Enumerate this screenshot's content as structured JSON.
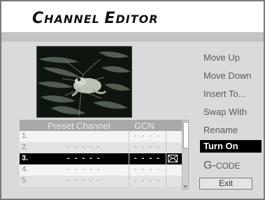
{
  "title": {
    "parts": [
      {
        "text": "C",
        "cap": true
      },
      {
        "text": "HANNEL ",
        "cap": false
      },
      {
        "text": "E",
        "cap": true
      },
      {
        "text": "DITOR",
        "cap": false
      }
    ]
  },
  "preview": {
    "icon": "frog-on-leaves-video-preview"
  },
  "table": {
    "headers": {
      "preset": "Preset Channel",
      "gcn": "GCN"
    },
    "rows": [
      {
        "num": "1.",
        "preset": "",
        "gcn": "- - - -",
        "icon": ""
      },
      {
        "num": "2.",
        "preset": "- - - - -",
        "gcn": "- - - -",
        "icon": ""
      },
      {
        "num": "3.",
        "preset": "- - - - -",
        "gcn": "- - - -",
        "icon": "mail-icon",
        "selected": true
      },
      {
        "num": "4.",
        "preset": "- - - - -",
        "gcn": "- - - -",
        "icon": ""
      },
      {
        "num": "5.",
        "preset": "- - - - -",
        "gcn": "- - - -",
        "icon": ""
      }
    ]
  },
  "menu": {
    "move_up": "Move Up",
    "move_down": "Move Down",
    "insert_to": "Insert To...",
    "swap_with": "Swap With",
    "rename": "Rename",
    "turn_on": "Turn On",
    "gcode_g": "G-",
    "gcode_rest": "CODE",
    "exit": "Exit"
  },
  "colors": {
    "selection": "#000000",
    "panel": "#dadada",
    "band": "#c4c4c4",
    "header": "#a8a8a8"
  }
}
